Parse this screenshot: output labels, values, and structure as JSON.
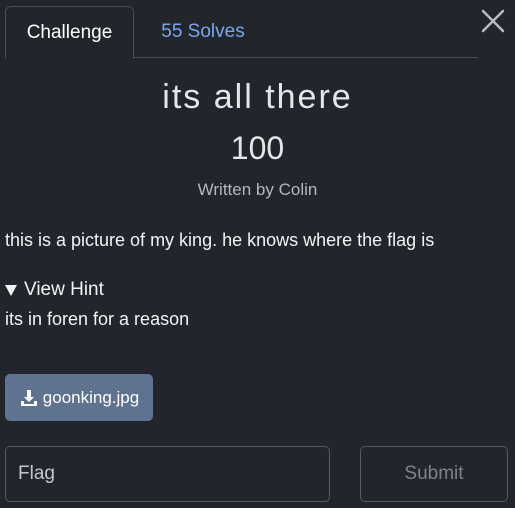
{
  "tabs": [
    {
      "label": "Challenge",
      "active": true
    },
    {
      "label": "55 Solves",
      "active": false
    }
  ],
  "close": {
    "icon": "close-icon"
  },
  "challenge": {
    "name": "its all there",
    "points": "100",
    "author": "Written by Colin",
    "description": "this is a picture of my king. he knows where the flag is",
    "hint_label": "View Hint",
    "hint_text": "its in foren for a reason"
  },
  "file": {
    "name": "goonking.jpg",
    "icon": "download-icon"
  },
  "submission": {
    "placeholder": "Flag",
    "value": "",
    "submit_label": "Submit"
  },
  "colors": {
    "background": "#22252b",
    "tab_link": "#7aa7e8",
    "file_button": "#5f7391",
    "border": "#555a62"
  }
}
